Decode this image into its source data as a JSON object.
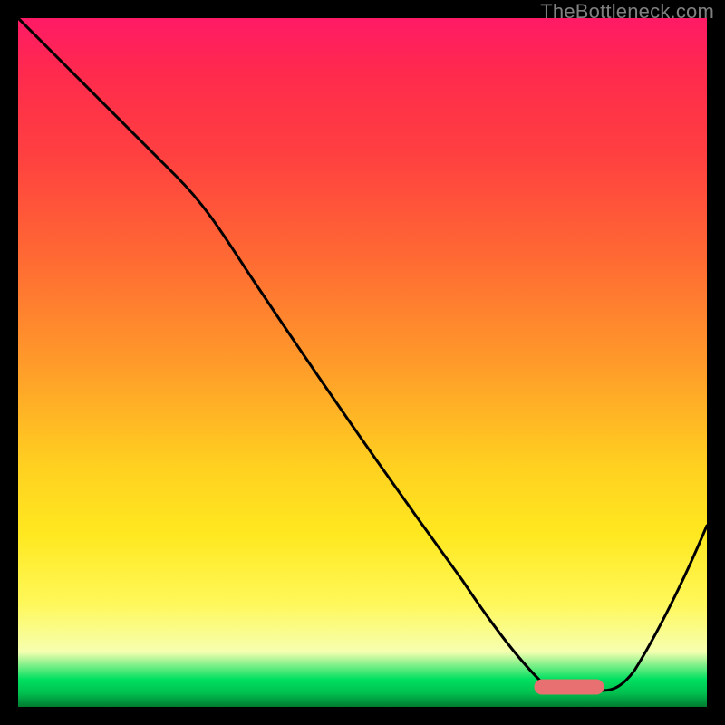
{
  "watermark": {
    "text": "TheBottleneck.com"
  },
  "colors": {
    "curve": "#000000",
    "sweet_spot": "#e97070",
    "gradient_stops": [
      "#ff1a66",
      "#ff2a4d",
      "#ff4040",
      "#ff6a33",
      "#ff9a2a",
      "#ffd020",
      "#ffe820",
      "#fff85a",
      "#f6ffb0",
      "#00e060",
      "#00c050",
      "#007a30"
    ]
  },
  "chart_data": {
    "type": "line",
    "title": "",
    "xlabel": "",
    "ylabel": "",
    "xlim": [
      0,
      100
    ],
    "ylim": [
      0,
      100
    ],
    "note": "y is a bottleneck percentage (0 = no bottleneck, green; 100 = severe, red). x is an unlabeled parameter sweep. Values estimated from pixel positions relative to the 760×760 plot area.",
    "series": [
      {
        "name": "bottleneck-curve",
        "x": [
          0,
          10,
          20,
          30,
          40,
          50,
          60,
          70,
          75,
          80,
          85,
          90,
          95,
          100
        ],
        "y": [
          100,
          90,
          80,
          67,
          53,
          40,
          26,
          12,
          4,
          0,
          0,
          6,
          16,
          27
        ]
      }
    ],
    "sweet_spot_range_x": [
      75,
      85
    ],
    "sweet_spot_y": 3
  }
}
